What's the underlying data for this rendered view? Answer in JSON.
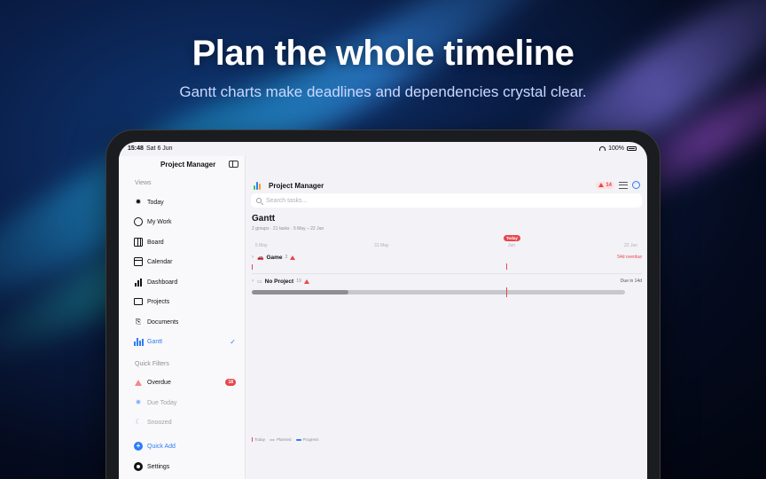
{
  "hero": {
    "title": "Plan the whole timeline",
    "subtitle": "Gantt charts make deadlines and dependencies crystal clear."
  },
  "status_bar": {
    "time": "15:48",
    "date": "Sat 6 Jun",
    "battery": "100%"
  },
  "sidebar": {
    "title": "Project Manager",
    "views_header": "Views",
    "views": [
      {
        "label": "Today",
        "icon": "sun-icon"
      },
      {
        "label": "My Work",
        "icon": "person-icon"
      },
      {
        "label": "Board",
        "icon": "board-icon"
      },
      {
        "label": "Calendar",
        "icon": "calendar-icon"
      },
      {
        "label": "Dashboard",
        "icon": "chart-bars-icon"
      },
      {
        "label": "Projects",
        "icon": "folder-icon"
      },
      {
        "label": "Documents",
        "icon": "paperclip-icon"
      },
      {
        "label": "Gantt",
        "icon": "gantt-icon",
        "selected": true
      }
    ],
    "filters_header": "Quick Filters",
    "filters": [
      {
        "label": "Overdue",
        "icon": "warning-icon",
        "badge": "18"
      },
      {
        "label": "Due Today",
        "icon": "sun-icon"
      },
      {
        "label": "Snoozed",
        "icon": "moon-icon"
      }
    ],
    "quick_add": "Quick Add",
    "settings": "Settings"
  },
  "toolbar": {
    "title": "Project Manager",
    "overdue_count": "14"
  },
  "search": {
    "placeholder": "Search tasks..."
  },
  "gantt": {
    "title": "Gantt",
    "meta": "2 groups · 21 tasks · 5 May – 22 Jun",
    "timeline_labels": [
      "5 May",
      "31 May",
      "Jun",
      "22 Jun"
    ],
    "today_label": "Today",
    "groups": [
      {
        "name": "Game",
        "emoji": "🚗",
        "count": "2",
        "status": "54d overdue",
        "status_color": "#e5484d",
        "progress": 0.0
      },
      {
        "name": "No Project",
        "emoji": "",
        "count": "19",
        "status": "Due in 14d",
        "status_color": "#555555",
        "progress": 0.26
      }
    ],
    "legend": [
      "Today",
      "Planned",
      "Progress"
    ]
  },
  "colors": {
    "accent": "#2f7cf6",
    "danger": "#e5484d"
  }
}
